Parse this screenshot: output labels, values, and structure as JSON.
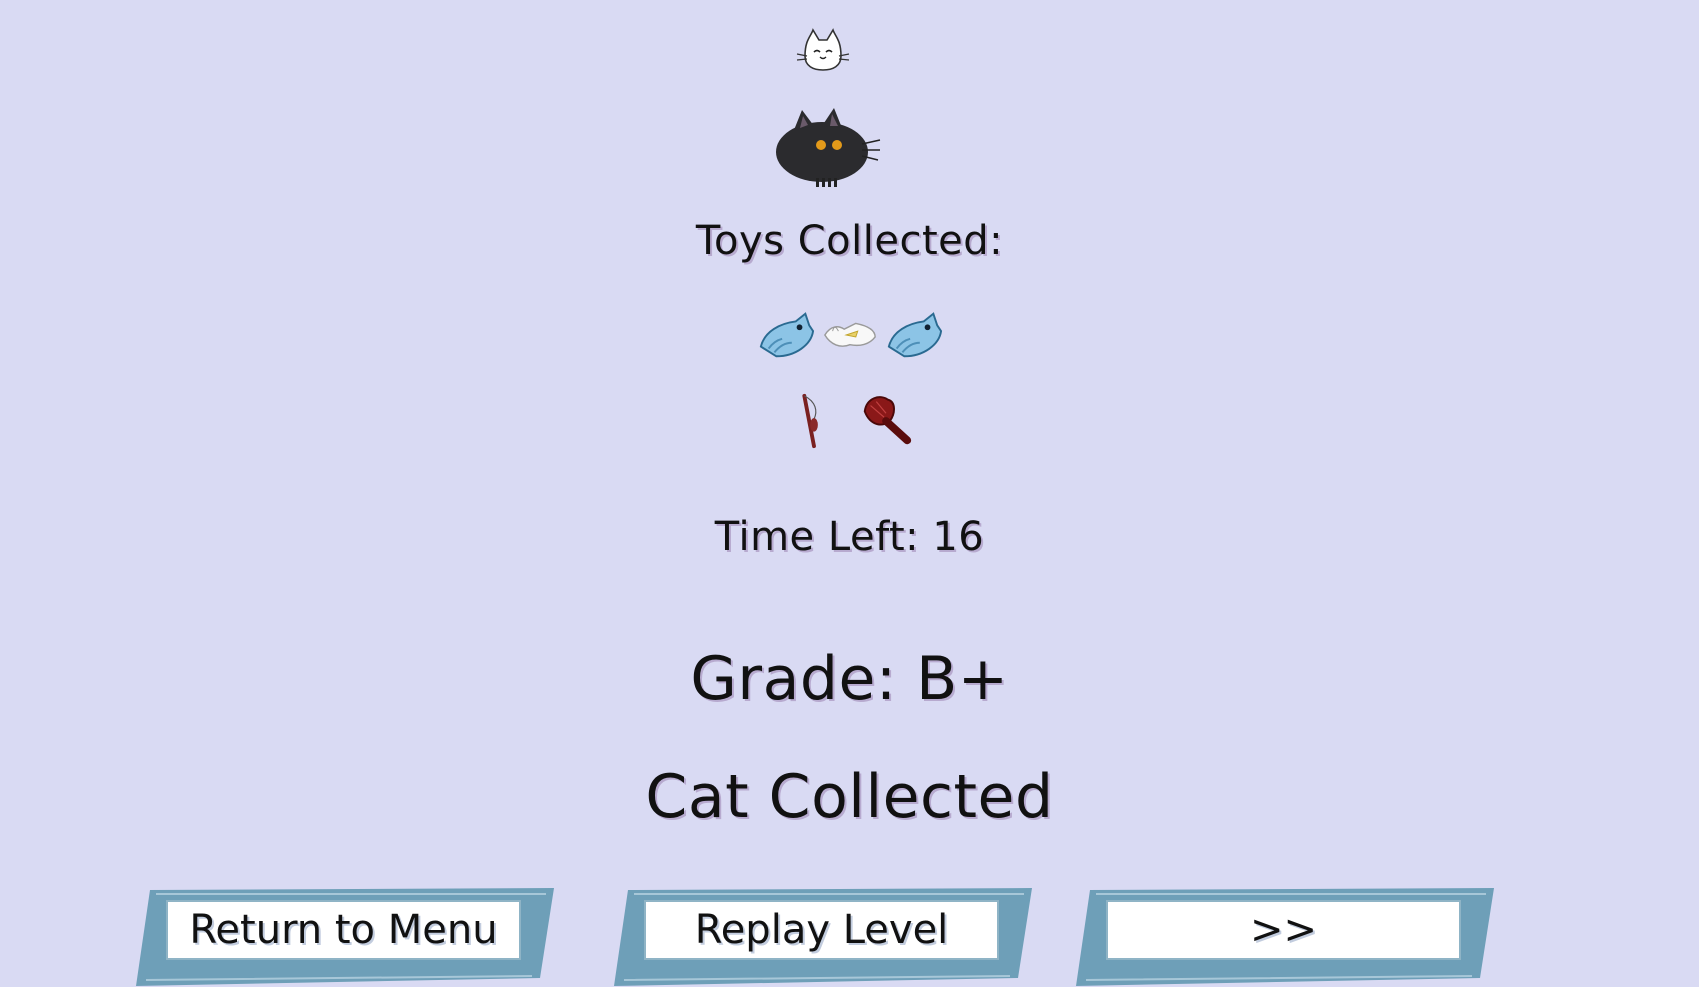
{
  "results": {
    "toys_title": "Toys Collected:",
    "toys_row1": [
      "fish-toy-icon",
      "plastic-bag-toy-icon",
      "fish-toy-icon"
    ],
    "toys_row2": [
      "wand-toy-icon",
      "feather-duster-toy-icon"
    ],
    "time_left": "Time Left: 16",
    "grade": "Grade: B+",
    "status": "Cat Collected"
  },
  "buttons": {
    "menu": "Return to Menu",
    "replay": "Replay Level",
    "next": ">>"
  },
  "colors": {
    "background": "#d9daf3",
    "button_frame": "#6e9fb8",
    "text": "#111111"
  }
}
